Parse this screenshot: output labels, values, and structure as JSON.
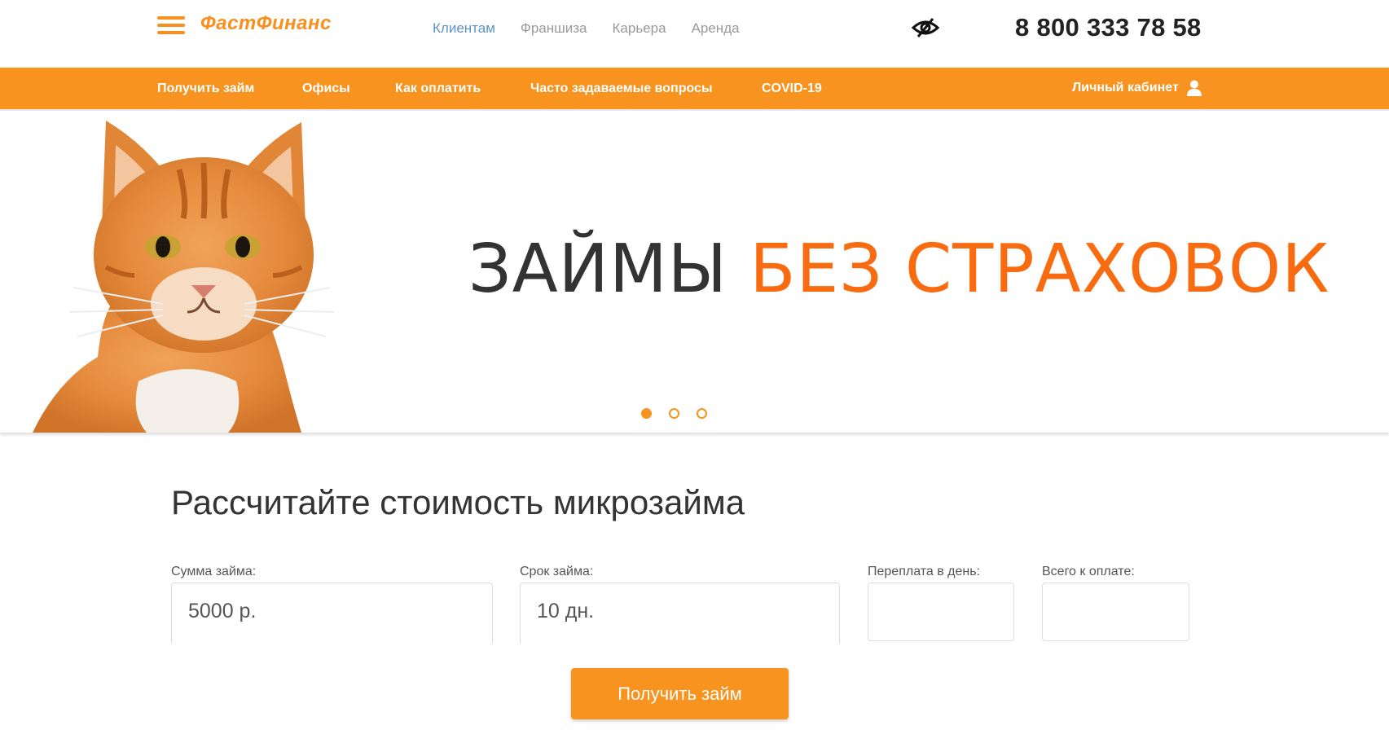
{
  "header": {
    "logo_text": "ФастФинанс",
    "nav": [
      {
        "label": "Клиентам",
        "active": true
      },
      {
        "label": "Франшиза",
        "active": false
      },
      {
        "label": "Карьера",
        "active": false
      },
      {
        "label": "Аренда",
        "active": false
      }
    ],
    "phone": "8 800 333 78 58",
    "icons": {
      "menu": "hamburger-menu-icon",
      "accessibility": "eye-slash-icon"
    }
  },
  "mainnav": {
    "items": [
      "Получить займ",
      "Офисы",
      "Как оплатить",
      "Часто задаваемые вопросы",
      "COVID-19"
    ],
    "cabinet_label": "Личный кабинет",
    "cabinet_icon": "user-icon"
  },
  "banner": {
    "headline_dark": "ЗАЙМЫ",
    "headline_orange": "БЕЗ СТРАХОВОК",
    "slides_total": 3,
    "active_slide": 1,
    "image": "ginger-cat-photo"
  },
  "calculator": {
    "title": "Рассчитайте стоимость микрозайма",
    "amount_label": "Сумма займа:",
    "amount_value": "5000 р.",
    "term_label": "Срок займа:",
    "term_value": "10 дн.",
    "overpay_label": "Переплата в день:",
    "overpay_value": "",
    "total_label": "Всего к оплате:",
    "total_value": "",
    "submit_label": "Получить займ"
  },
  "colors": {
    "brand_orange": "#f7931e",
    "headline_orange": "#f96b10",
    "link_blue": "#5d93c6"
  }
}
